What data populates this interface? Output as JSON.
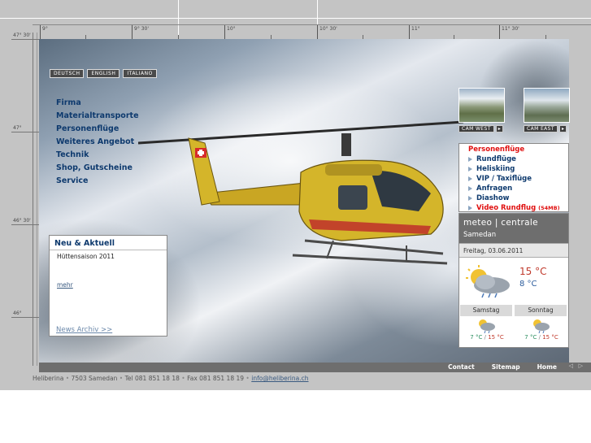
{
  "coords": {
    "lon": [
      "9°",
      "9° 30'",
      "10°",
      "10° 30'",
      "11°",
      "11° 30'"
    ],
    "lat": [
      "47° 30'",
      "47°",
      "46° 30'",
      "46°"
    ]
  },
  "languages": [
    "DEUTSCH",
    "ENGLISH",
    "ITALIANO"
  ],
  "nav": [
    "Firma",
    "Materialtransporte",
    "Personenflüge",
    "Weiteres Angebot",
    "Technik",
    "Shop, Gutscheine",
    "Service"
  ],
  "news": {
    "title": "Neu & Aktuell",
    "item": "Hüttensaison 2011",
    "more": "mehr",
    "archive": "News Archiv >>"
  },
  "webcams": {
    "west": "CAM WEST",
    "east": "CAM EAST",
    "arrow": "▸"
  },
  "right_menu": {
    "active": "Personenflüge",
    "items": [
      "Rundflüge",
      "Heliskiing",
      "VIP / Taxiflüge",
      "Anfragen",
      "Diashow"
    ],
    "video": "Video Rundflug",
    "video_size": "(54MB)"
  },
  "weather": {
    "brand": "meteo | centrale",
    "location": "Samedan",
    "date": "Freitag, 03.06.2011",
    "tmax": "15 °C",
    "tmin": "8 °C",
    "forecast": [
      {
        "day": "Samstag",
        "lo": "7 °C",
        "hi": "15 °C"
      },
      {
        "day": "Sonntag",
        "lo": "7 °C",
        "hi": "15 °C"
      }
    ],
    "slash": "/",
    "icon_today": "sun-cloud-rain-icon",
    "icon_forecast": "sun-cloud-rain-small-icon"
  },
  "footer": {
    "links": [
      "Contact",
      "Sitemap",
      "Home"
    ],
    "prev": "◁",
    "next": "▷"
  },
  "address": {
    "company": "Heliberina",
    "town": "7503 Samedan",
    "tel": "Tel 081 851 18 18",
    "fax": "Fax 081 851 18 19",
    "email": "info@heliberina.ch",
    "dot": "•"
  },
  "colors": {
    "nav": "#0e3a6e",
    "active": "#e01010",
    "bar": "#6e6e6e",
    "helicopter": "#d4b52a"
  }
}
